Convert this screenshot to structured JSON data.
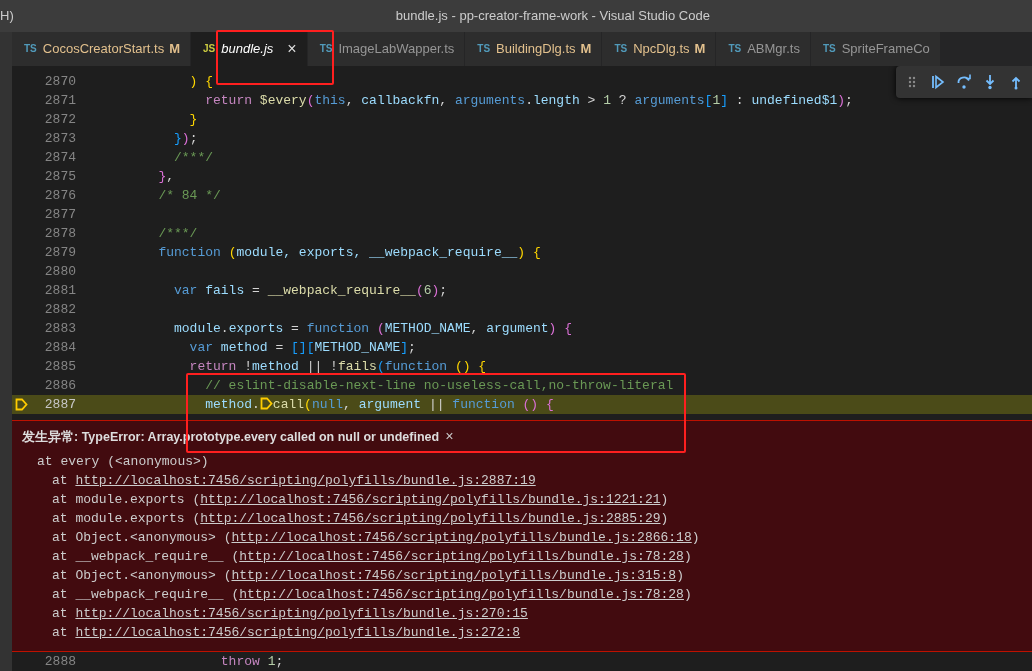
{
  "window": {
    "menu_fragment": "H)",
    "title": "bundle.js - pp-creator-frame-work - Visual Studio Code"
  },
  "tabs": [
    {
      "lang": "TS",
      "label": "CocosCreatorStart.ts",
      "modified": true,
      "badge": "M",
      "selected": false,
      "preview": false
    },
    {
      "lang": "JS",
      "label": "bundle.js",
      "modified": false,
      "selected": true,
      "preview": true,
      "close": "×"
    },
    {
      "lang": "TS",
      "label": "ImageLabWapper.ts",
      "modified": false,
      "selected": false,
      "preview": false
    },
    {
      "lang": "TS",
      "label": "BuildingDlg.ts",
      "modified": true,
      "badge": "M",
      "selected": false,
      "preview": false
    },
    {
      "lang": "TS",
      "label": "NpcDlg.ts",
      "modified": true,
      "badge": "M",
      "selected": false,
      "preview": false
    },
    {
      "lang": "TS",
      "label": "ABMgr.ts",
      "modified": false,
      "selected": false,
      "preview": false
    },
    {
      "lang": "TS",
      "label": "SpriteFrameCo",
      "modified": false,
      "selected": false,
      "preview": false
    }
  ],
  "code_lines": [
    {
      "number": "2870",
      "current": false,
      "tokens": [
        {
          "t": "            ) {",
          "kind": "b1"
        }
      ]
    },
    {
      "number": "2871",
      "current": false,
      "tokens": [
        {
          "t": "              return ",
          "kind": "ctrl"
        },
        {
          "t": "$every",
          "kind": "fn"
        },
        {
          "t": "(",
          "kind": "b2"
        },
        {
          "t": "this",
          "kind": "kw"
        },
        {
          "t": ", "
        },
        {
          "t": "callbackfn",
          "kind": "var"
        },
        {
          "t": ", "
        },
        {
          "t": "arguments",
          "kind": "kw"
        },
        {
          "t": "."
        },
        {
          "t": "length",
          "kind": "var"
        },
        {
          "t": " > "
        },
        {
          "t": "1",
          "kind": "num"
        },
        {
          "t": " ? "
        },
        {
          "t": "arguments",
          "kind": "kw"
        },
        {
          "t": "[",
          "kind": "b3"
        },
        {
          "t": "1",
          "kind": "num"
        },
        {
          "t": "]",
          "kind": "b3"
        },
        {
          "t": " : "
        },
        {
          "t": "undefined$1",
          "kind": "var"
        },
        {
          "t": ")",
          "kind": "b2"
        },
        {
          "t": ";"
        }
      ]
    },
    {
      "number": "2872",
      "current": false,
      "tokens": [
        {
          "t": "            }",
          "kind": "b1"
        }
      ]
    },
    {
      "number": "2873",
      "current": false,
      "tokens": [
        {
          "t": "          }",
          "kind": "b3"
        },
        {
          "t": ")",
          "kind": "b2"
        },
        {
          "t": ";"
        }
      ]
    },
    {
      "number": "2874",
      "current": false,
      "tokens": [
        {
          "t": "          /***/",
          "kind": "comment"
        }
      ]
    },
    {
      "number": "2875",
      "current": false,
      "tokens": [
        {
          "t": "        }",
          "kind": "b2"
        },
        {
          "t": ","
        }
      ]
    },
    {
      "number": "2876",
      "current": false,
      "tokens": [
        {
          "t": "        /* 84 */",
          "kind": "comment"
        }
      ]
    },
    {
      "number": "2877",
      "current": false
    },
    {
      "number": "2878",
      "current": false,
      "tokens": [
        {
          "t": "        /***/",
          "kind": "comment"
        }
      ]
    },
    {
      "number": "2879",
      "current": false,
      "tokens": [
        {
          "t": "        function ",
          "kind": "kw"
        },
        {
          "t": "(",
          "kind": "b1"
        },
        {
          "t": "module, exports, __webpack_require__",
          "kind": "var"
        },
        {
          "t": ") {",
          "kind": "b1"
        }
      ]
    },
    {
      "number": "2880",
      "current": false
    },
    {
      "number": "2881",
      "current": false,
      "tokens": [
        {
          "t": "          var ",
          "kind": "kw"
        },
        {
          "t": "fails",
          "kind": "var"
        },
        {
          "t": " = "
        },
        {
          "t": "__webpack_require__",
          "kind": "fn"
        },
        {
          "t": "(",
          "kind": "b2"
        },
        {
          "t": "6",
          "kind": "num"
        },
        {
          "t": ")",
          "kind": "b2"
        },
        {
          "t": ";"
        }
      ]
    },
    {
      "number": "2882",
      "current": false
    },
    {
      "number": "2883",
      "current": false,
      "tokens": [
        {
          "t": "          module",
          "kind": "var"
        },
        {
          "t": "."
        },
        {
          "t": "exports",
          "kind": "var"
        },
        {
          "t": " = "
        },
        {
          "t": "function ",
          "kind": "kw"
        },
        {
          "t": "(",
          "kind": "b2"
        },
        {
          "t": "METHOD_NAME",
          "kind": "var"
        },
        {
          "t": ", "
        },
        {
          "t": "argument",
          "kind": "var"
        },
        {
          "t": ") {",
          "kind": "b2"
        }
      ]
    },
    {
      "number": "2884",
      "current": false,
      "tokens": [
        {
          "t": "            var ",
          "kind": "kw"
        },
        {
          "t": "method",
          "kind": "var"
        },
        {
          "t": " = "
        },
        {
          "t": "[][",
          "kind": "b3"
        },
        {
          "t": "METHOD_NAME",
          "kind": "var"
        },
        {
          "t": "]",
          "kind": "b3"
        },
        {
          "t": ";"
        }
      ]
    },
    {
      "number": "2885",
      "current": false,
      "tokens": [
        {
          "t": "            return",
          "kind": "ctrl"
        },
        {
          "t": " !"
        },
        {
          "t": "method",
          "kind": "var"
        },
        {
          "t": " || !"
        },
        {
          "t": "fails",
          "kind": "fn"
        },
        {
          "t": "(",
          "kind": "b3"
        },
        {
          "t": "function ",
          "kind": "kw"
        },
        {
          "t": "() {",
          "kind": "b1"
        }
      ]
    },
    {
      "number": "2886",
      "current": false,
      "tokens": [
        {
          "t": "              // eslint-disable-next-line no-useless-call,no-throw-literal",
          "kind": "comment"
        }
      ]
    },
    {
      "number": "2887",
      "current": true,
      "tokens": [
        {
          "t": "              method",
          "kind": "var"
        },
        {
          "t": "."
        },
        {
          "kind": "frame"
        },
        {
          "t": "call",
          "kind": "fn"
        },
        {
          "t": "(",
          "kind": "b1"
        },
        {
          "t": "null",
          "kind": "kw"
        },
        {
          "t": ", "
        },
        {
          "t": "argument",
          "kind": "var"
        },
        {
          "t": " || "
        },
        {
          "t": "function ",
          "kind": "kw"
        },
        {
          "t": "() {",
          "kind": "b2"
        }
      ]
    }
  ],
  "exception": {
    "title": "发生异常: TypeError: Array.prototype.every called on null or undefined",
    "close": "×",
    "stack": [
      {
        "kind": "message",
        "before": "at every (<anonymous>)"
      },
      {
        "kind": "frame",
        "before": "at ",
        "link": "http://localhost:7456/scripting/polyfills/bundle.js:2887:19"
      },
      {
        "kind": "frame",
        "before": "at module.exports (",
        "link": "http://localhost:7456/scripting/polyfills/bundle.js:1221:21",
        "after": ")"
      },
      {
        "kind": "frame",
        "before": "at module.exports (",
        "link": "http://localhost:7456/scripting/polyfills/bundle.js:2885:29",
        "after": ")"
      },
      {
        "kind": "frame",
        "before": "at Object.<anonymous> (",
        "link": "http://localhost:7456/scripting/polyfills/bundle.js:2866:18",
        "after": ")"
      },
      {
        "kind": "frame",
        "before": "at __webpack_require__ (",
        "link": "http://localhost:7456/scripting/polyfills/bundle.js:78:28",
        "after": ")"
      },
      {
        "kind": "frame",
        "before": "at Object.<anonymous> (",
        "link": "http://localhost:7456/scripting/polyfills/bundle.js:315:8",
        "after": ")"
      },
      {
        "kind": "frame",
        "before": "at __webpack_require__ (",
        "link": "http://localhost:7456/scripting/polyfills/bundle.js:78:28",
        "after": ")"
      },
      {
        "kind": "frame",
        "before": "at ",
        "link": "http://localhost:7456/scripting/polyfills/bundle.js:270:15"
      },
      {
        "kind": "frame",
        "before": "at ",
        "link": "http://localhost:7456/scripting/polyfills/bundle.js:272:8"
      }
    ]
  },
  "after_lines": [
    {
      "number": "2888",
      "current": false,
      "tokens": [
        {
          "t": "                throw ",
          "kind": "ctrl"
        },
        {
          "t": "1",
          "kind": "num"
        },
        {
          "t": ";"
        }
      ]
    }
  ],
  "debug_toolbar": [
    {
      "kind": "grip"
    },
    {
      "kind": "continue"
    },
    {
      "kind": "step-over"
    },
    {
      "kind": "step-into"
    },
    {
      "kind": "step-out"
    }
  ]
}
